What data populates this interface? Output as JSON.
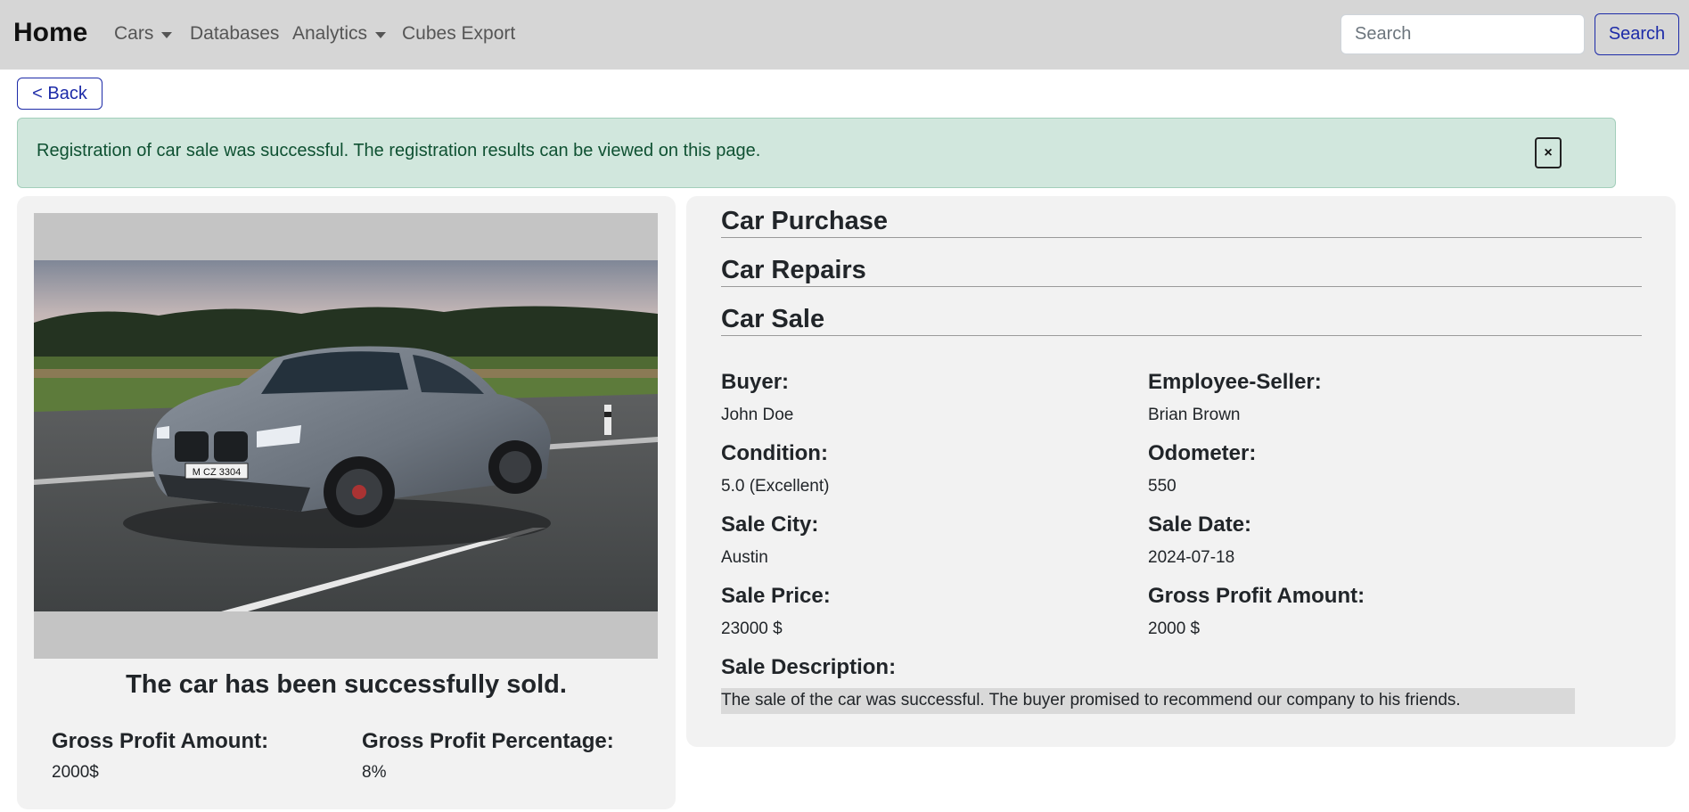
{
  "navbar": {
    "brand": "Home",
    "items": [
      {
        "label": "Cars",
        "dropdown": true
      },
      {
        "label": "Databases",
        "dropdown": false
      },
      {
        "label": "Analytics",
        "dropdown": true
      },
      {
        "label": "Cubes Export",
        "dropdown": false
      }
    ],
    "search_placeholder": "Search",
    "search_button": "Search"
  },
  "back_button": "< Back",
  "alert": {
    "message": "Registration of car sale was successful. The registration results can be viewed on this page.",
    "close_label": "×"
  },
  "summary": {
    "title": "The car has been successfully sold.",
    "gross_profit_amount_label": "Gross Profit Amount:",
    "gross_profit_amount_value": "2000$",
    "gross_profit_percentage_label": "Gross Profit Percentage:",
    "gross_profit_percentage_value": "8%"
  },
  "car_photo": {
    "plate": "M CZ 3304"
  },
  "sections": {
    "purchase": "Car Purchase",
    "repairs": "Car Repairs",
    "sale": "Car Sale"
  },
  "sale": {
    "buyer_label": "Buyer:",
    "buyer": "John Doe",
    "employee_label": "Employee-Seller:",
    "employee": "Brian Brown",
    "condition_label": "Condition:",
    "condition": "5.0 (Excellent)",
    "odometer_label": "Odometer:",
    "odometer": "550",
    "city_label": "Sale City:",
    "city": "Austin",
    "date_label": "Sale Date:",
    "date": "2024-07-18",
    "price_label": "Sale Price:",
    "price": "23000 $",
    "gross_profit_label": "Gross Profit Amount:",
    "gross_profit": "2000 $",
    "description_label": "Sale Description:",
    "description": "The sale of the car was successful. The buyer promised to recommend our company to his friends."
  },
  "colors": {
    "navbar_bg": "#d6d6d6",
    "primary": "#1d2ba8",
    "alert_bg": "#d1e7dd",
    "card_bg": "#f2f2f2"
  }
}
